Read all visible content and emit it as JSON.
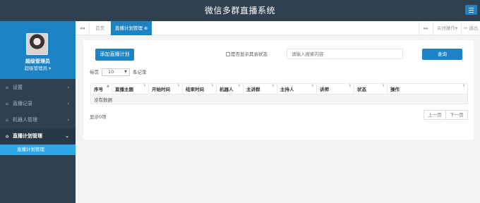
{
  "header": {
    "title": "微信多群直播系统",
    "menu_icon": "hamburger-icon"
  },
  "profile": {
    "name": "超级管理员",
    "role": "超级管理员 ▾"
  },
  "sidebar": {
    "items": [
      {
        "label": "设置",
        "icon": "home-icon",
        "chevron": "‹"
      },
      {
        "label": "直播记录",
        "icon": "home-icon",
        "chevron": "‹"
      },
      {
        "label": "机器人管理",
        "icon": "home-icon",
        "chevron": "‹"
      },
      {
        "label": "直播计划管理",
        "icon": "home-icon",
        "chevron": "⌄"
      }
    ],
    "sub_items": [
      {
        "label": "直播计划管理"
      }
    ]
  },
  "tabs": {
    "prev": "◂◂",
    "home": "首页",
    "active": "直播计划管理",
    "active_close": "⊗",
    "next": "▸▸",
    "close_ops": "关闭操作▾",
    "logout": "↦ 退出"
  },
  "toolbar": {
    "add_label": "添加直播计划",
    "checkbox_label": "是否显示其余状态",
    "search_placeholder": "请输入搜索内容",
    "query_label": "查询"
  },
  "pagesize": {
    "prefix": "每页",
    "value": "10",
    "suffix": "条记录"
  },
  "table": {
    "headers": [
      "序号",
      "直播主题",
      "开始时间",
      "结束时间",
      "机器人",
      "主讲群",
      "主持人",
      "讲师",
      "状态",
      "操作"
    ],
    "sort_glyphs": [
      "▲",
      "⇕",
      "⇕",
      "⇕",
      "⇕",
      "⇕",
      "⇕",
      "⇕",
      "⇕",
      "⇕"
    ],
    "empty_text": "没有数据"
  },
  "footer": {
    "info": "显示0项",
    "prev": "上一页",
    "next": "下一页"
  }
}
